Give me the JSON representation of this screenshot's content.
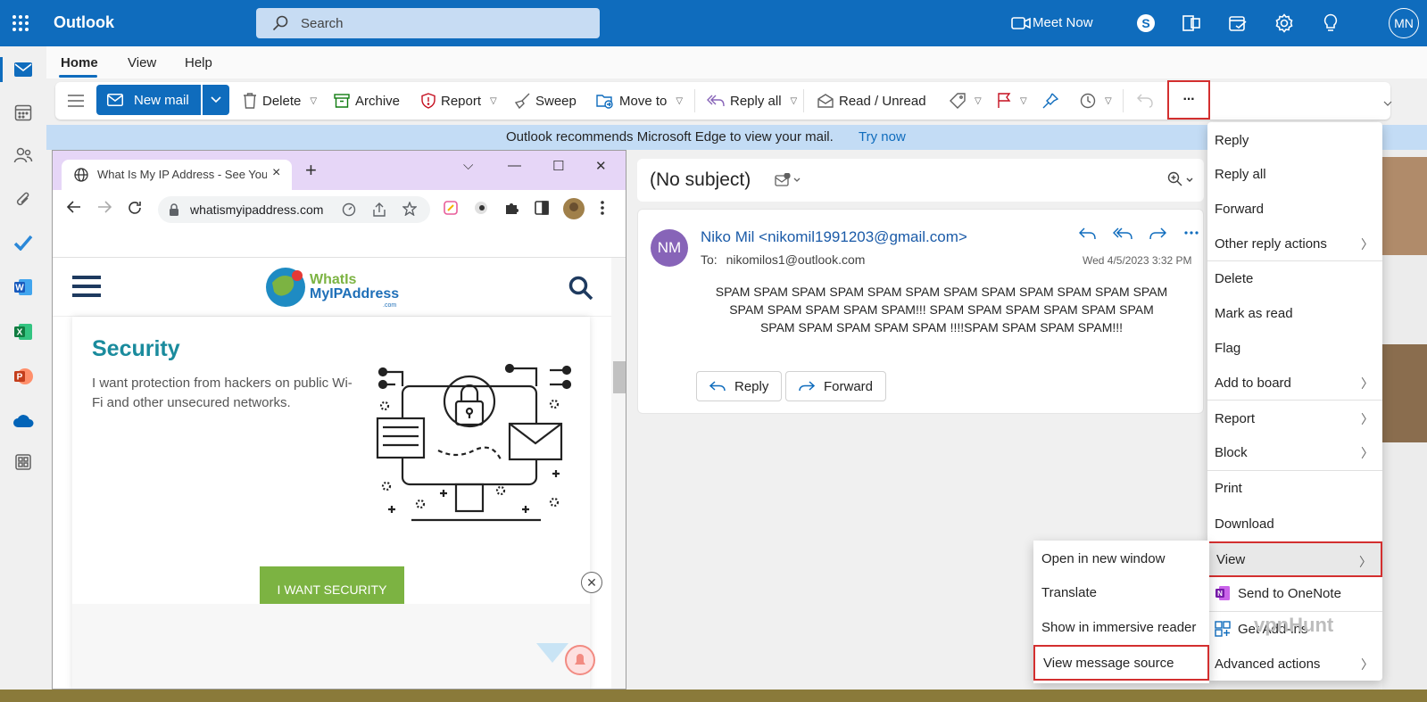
{
  "app": {
    "brand": "Outlook",
    "search_placeholder": "Search",
    "meet_now": "Meet Now",
    "user_initials": "MN"
  },
  "ribbon_tabs": [
    "Home",
    "View",
    "Help"
  ],
  "ribbon": {
    "new_mail": "New mail",
    "delete": "Delete",
    "archive": "Archive",
    "report": "Report",
    "sweep": "Sweep",
    "move_to": "Move to",
    "reply_all": "Reply all",
    "read_unread": "Read / Unread",
    "more": "···"
  },
  "banner": {
    "text": "Outlook recommends Microsoft Edge to view your mail.",
    "link": "Try now"
  },
  "browser": {
    "tab_title": "What Is My IP Address - See Your",
    "url": "whatismyipaddress.com",
    "logo_line1": "WhatIs",
    "logo_line2": "MyIPAddress",
    "logo_line3": ".com",
    "section_title": "Security",
    "section_desc": "I want protection from hackers on public Wi-Fi and other unsecured networks.",
    "cta": "I WANT SECURITY"
  },
  "message": {
    "subject": "(No subject)",
    "sender_initials": "NM",
    "sender": "Niko Mil <nikomil1991203@gmail.com>",
    "to_label": "To:",
    "to": "nikomilos1@outlook.com",
    "date": "Wed 4/5/2023 3:32 PM",
    "body_line1": "SPAM SPAM SPAM SPAM SPAM SPAM SPAM SPAM SPAM SPAM SPAM SPAM",
    "body_line2": "SPAM SPAM SPAM SPAM SPAM!!! SPAM SPAM SPAM SPAM SPAM SPAM",
    "body_line3": "SPAM SPAM SPAM SPAM SPAM !!!!SPAM SPAM SPAM SPAM!!!",
    "reply": "Reply",
    "forward": "Forward"
  },
  "menu": {
    "items": [
      "Reply",
      "Reply all",
      "Forward",
      "Other reply actions",
      "Delete",
      "Mark as read",
      "Flag",
      "Add to board",
      "Report",
      "Block",
      "Print",
      "Download",
      "View",
      "Send to OneNote",
      "Get Add-ins",
      "Advanced actions"
    ]
  },
  "submenu": {
    "items": [
      "Open in new window",
      "Translate",
      "Show in immersive reader",
      "View message source"
    ]
  },
  "watermark": "vpnHunt",
  "colors": {
    "brand_blue": "#0f6cbd",
    "highlight_red": "#d32f2f",
    "avatar_purple": "#8764b8"
  }
}
